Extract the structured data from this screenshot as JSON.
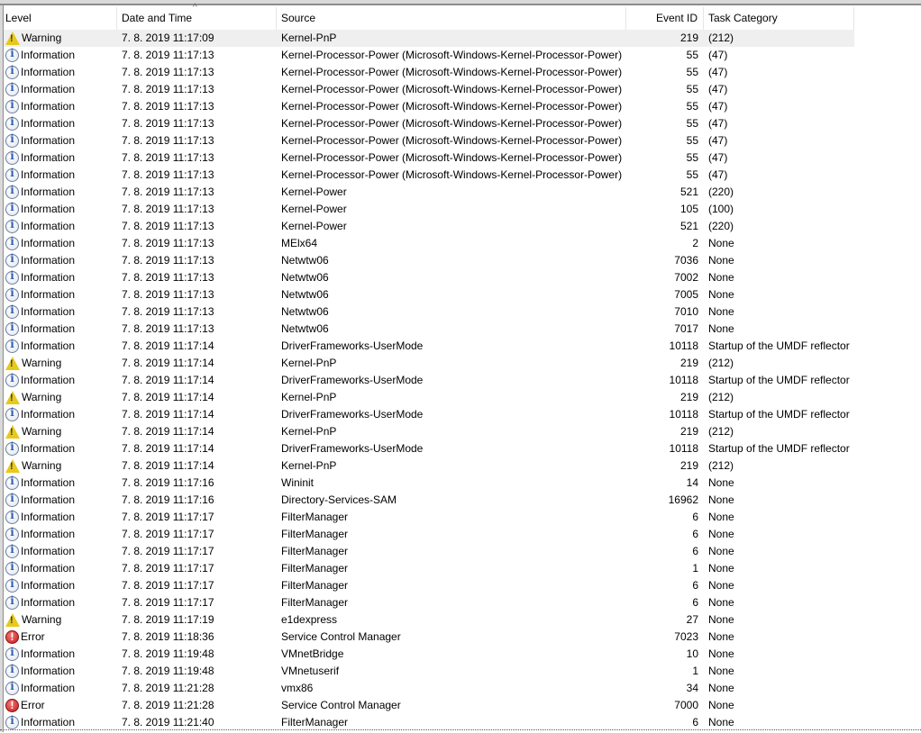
{
  "columns": [
    "Level",
    "Date and Time",
    "Source",
    "Event ID",
    "Task Category"
  ],
  "sort": {
    "column": "Date and Time",
    "direction": "ascending"
  },
  "level_icons": {
    "Information": "info-icon",
    "Warning": "warning-icon",
    "Error": "error-icon"
  },
  "selected_row": 0,
  "rows": [
    [
      "Warning",
      "7. 8. 2019 11:17:09",
      "Kernel-PnP",
      "219",
      "(212)"
    ],
    [
      "Information",
      "7. 8. 2019 11:17:13",
      "Kernel-Processor-Power (Microsoft-Windows-Kernel-Processor-Power)",
      "55",
      "(47)"
    ],
    [
      "Information",
      "7. 8. 2019 11:17:13",
      "Kernel-Processor-Power (Microsoft-Windows-Kernel-Processor-Power)",
      "55",
      "(47)"
    ],
    [
      "Information",
      "7. 8. 2019 11:17:13",
      "Kernel-Processor-Power (Microsoft-Windows-Kernel-Processor-Power)",
      "55",
      "(47)"
    ],
    [
      "Information",
      "7. 8. 2019 11:17:13",
      "Kernel-Processor-Power (Microsoft-Windows-Kernel-Processor-Power)",
      "55",
      "(47)"
    ],
    [
      "Information",
      "7. 8. 2019 11:17:13",
      "Kernel-Processor-Power (Microsoft-Windows-Kernel-Processor-Power)",
      "55",
      "(47)"
    ],
    [
      "Information",
      "7. 8. 2019 11:17:13",
      "Kernel-Processor-Power (Microsoft-Windows-Kernel-Processor-Power)",
      "55",
      "(47)"
    ],
    [
      "Information",
      "7. 8. 2019 11:17:13",
      "Kernel-Processor-Power (Microsoft-Windows-Kernel-Processor-Power)",
      "55",
      "(47)"
    ],
    [
      "Information",
      "7. 8. 2019 11:17:13",
      "Kernel-Processor-Power (Microsoft-Windows-Kernel-Processor-Power)",
      "55",
      "(47)"
    ],
    [
      "Information",
      "7. 8. 2019 11:17:13",
      "Kernel-Power",
      "521",
      "(220)"
    ],
    [
      "Information",
      "7. 8. 2019 11:17:13",
      "Kernel-Power",
      "105",
      "(100)"
    ],
    [
      "Information",
      "7. 8. 2019 11:17:13",
      "Kernel-Power",
      "521",
      "(220)"
    ],
    [
      "Information",
      "7. 8. 2019 11:17:13",
      "MElx64",
      "2",
      "None"
    ],
    [
      "Information",
      "7. 8. 2019 11:17:13",
      "Netwtw06",
      "7036",
      "None"
    ],
    [
      "Information",
      "7. 8. 2019 11:17:13",
      "Netwtw06",
      "7002",
      "None"
    ],
    [
      "Information",
      "7. 8. 2019 11:17:13",
      "Netwtw06",
      "7005",
      "None"
    ],
    [
      "Information",
      "7. 8. 2019 11:17:13",
      "Netwtw06",
      "7010",
      "None"
    ],
    [
      "Information",
      "7. 8. 2019 11:17:13",
      "Netwtw06",
      "7017",
      "None"
    ],
    [
      "Information",
      "7. 8. 2019 11:17:14",
      "DriverFrameworks-UserMode",
      "10118",
      "Startup of the UMDF reflector"
    ],
    [
      "Warning",
      "7. 8. 2019 11:17:14",
      "Kernel-PnP",
      "219",
      "(212)"
    ],
    [
      "Information",
      "7. 8. 2019 11:17:14",
      "DriverFrameworks-UserMode",
      "10118",
      "Startup of the UMDF reflector"
    ],
    [
      "Warning",
      "7. 8. 2019 11:17:14",
      "Kernel-PnP",
      "219",
      "(212)"
    ],
    [
      "Information",
      "7. 8. 2019 11:17:14",
      "DriverFrameworks-UserMode",
      "10118",
      "Startup of the UMDF reflector"
    ],
    [
      "Warning",
      "7. 8. 2019 11:17:14",
      "Kernel-PnP",
      "219",
      "(212)"
    ],
    [
      "Information",
      "7. 8. 2019 11:17:14",
      "DriverFrameworks-UserMode",
      "10118",
      "Startup of the UMDF reflector"
    ],
    [
      "Warning",
      "7. 8. 2019 11:17:14",
      "Kernel-PnP",
      "219",
      "(212)"
    ],
    [
      "Information",
      "7. 8. 2019 11:17:16",
      "Wininit",
      "14",
      "None"
    ],
    [
      "Information",
      "7. 8. 2019 11:17:16",
      "Directory-Services-SAM",
      "16962",
      "None"
    ],
    [
      "Information",
      "7. 8. 2019 11:17:17",
      "FilterManager",
      "6",
      "None"
    ],
    [
      "Information",
      "7. 8. 2019 11:17:17",
      "FilterManager",
      "6",
      "None"
    ],
    [
      "Information",
      "7. 8. 2019 11:17:17",
      "FilterManager",
      "6",
      "None"
    ],
    [
      "Information",
      "7. 8. 2019 11:17:17",
      "FilterManager",
      "1",
      "None"
    ],
    [
      "Information",
      "7. 8. 2019 11:17:17",
      "FilterManager",
      "6",
      "None"
    ],
    [
      "Information",
      "7. 8. 2019 11:17:17",
      "FilterManager",
      "6",
      "None"
    ],
    [
      "Warning",
      "7. 8. 2019 11:17:19",
      "e1dexpress",
      "27",
      "None"
    ],
    [
      "Error",
      "7. 8. 2019 11:18:36",
      "Service Control Manager",
      "7023",
      "None"
    ],
    [
      "Information",
      "7. 8. 2019 11:19:48",
      "VMnetBridge",
      "10",
      "None"
    ],
    [
      "Information",
      "7. 8. 2019 11:19:48",
      "VMnetuserif",
      "1",
      "None"
    ],
    [
      "Information",
      "7. 8. 2019 11:21:28",
      "vmx86",
      "34",
      "None"
    ],
    [
      "Error",
      "7. 8. 2019 11:21:28",
      "Service Control Manager",
      "7000",
      "None"
    ],
    [
      "Information",
      "7. 8. 2019 11:21:40",
      "FilterManager",
      "6",
      "None"
    ]
  ]
}
